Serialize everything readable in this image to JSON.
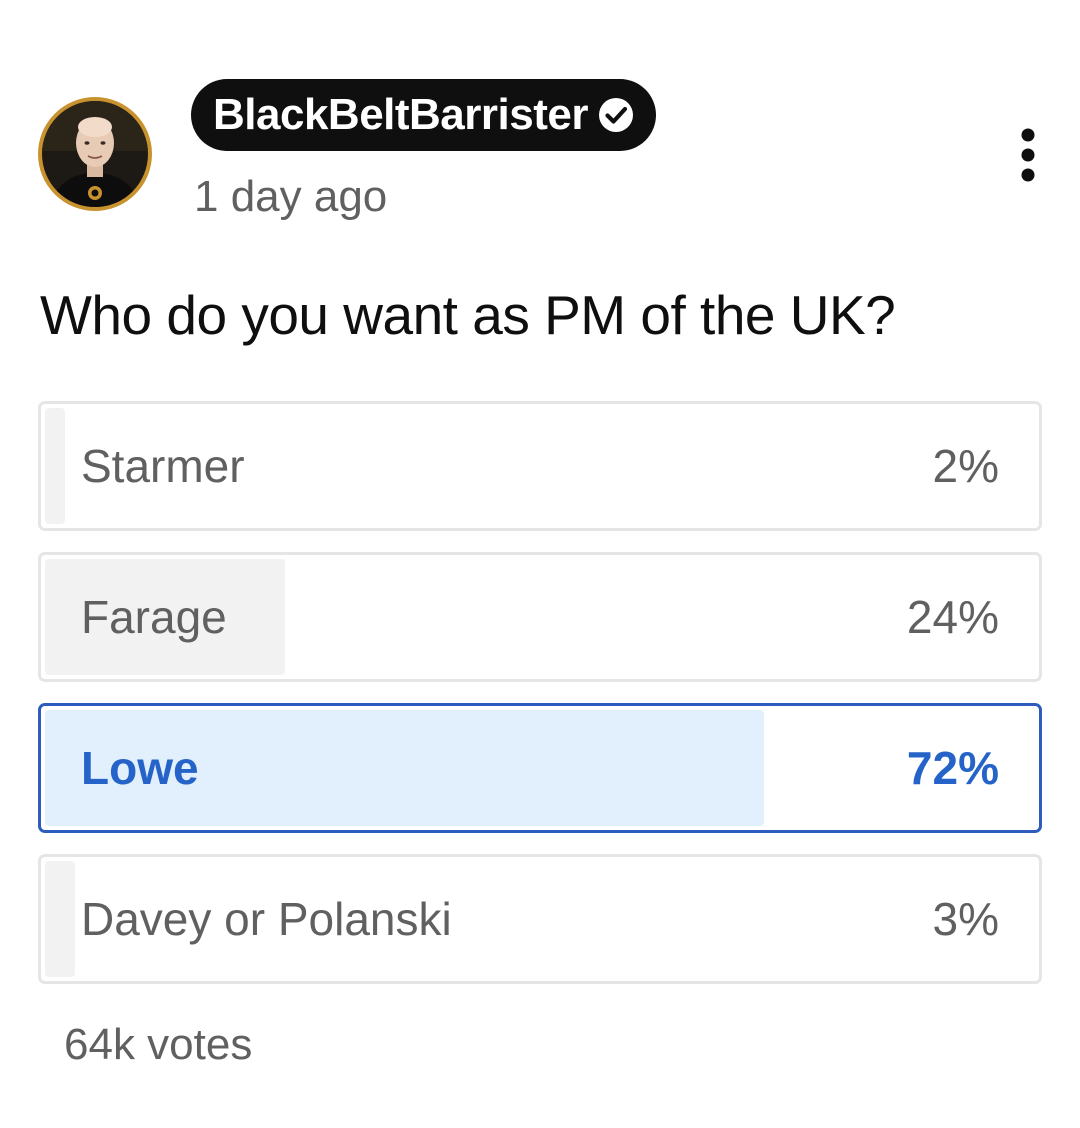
{
  "post": {
    "channel_name": "BlackBeltBarrister",
    "verified_icon": "verified-check-icon",
    "timestamp": "1 day ago",
    "menu_icon": "more-vertical-icon"
  },
  "poll": {
    "question": "Who do you want as PM of the UK?",
    "options": [
      {
        "label": "Starmer",
        "percent_text": "2%",
        "percent": 2,
        "selected": false
      },
      {
        "label": "Farage",
        "percent_text": "24%",
        "percent": 24,
        "selected": false
      },
      {
        "label": "Lowe",
        "percent_text": "72%",
        "percent": 72,
        "selected": true
      },
      {
        "label": "Davey or Polanski",
        "percent_text": "3%",
        "percent": 3,
        "selected": false
      }
    ],
    "votes": "64k votes"
  },
  "colors": {
    "pill_background": "#0f0f0f",
    "avatar_ring": "#c8922e",
    "selected_accent": "#2563c9",
    "selected_fill": "#e2effd",
    "result_fill": "#f2f2f2",
    "secondary_text": "#606060"
  }
}
